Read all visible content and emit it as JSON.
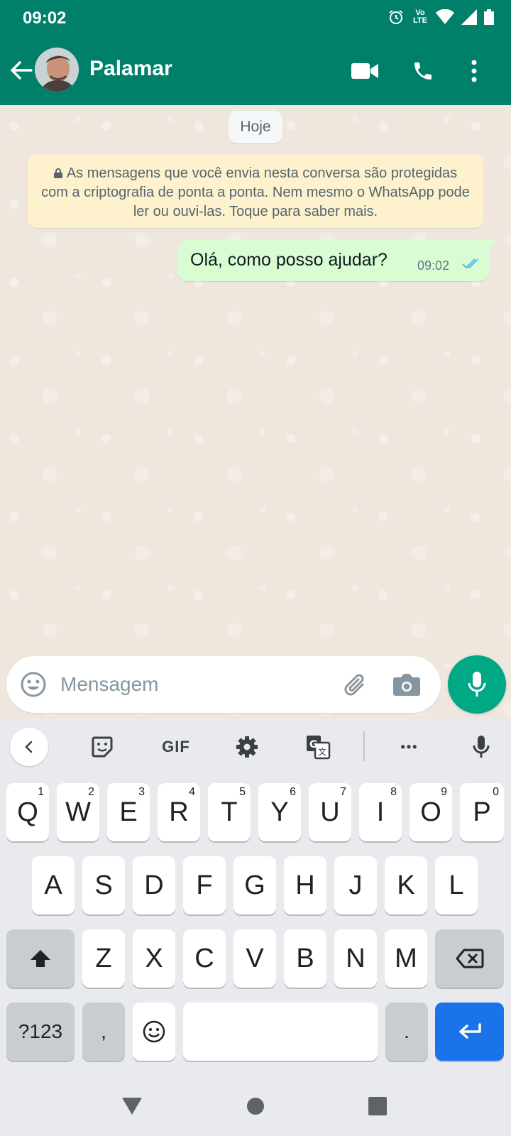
{
  "status_bar": {
    "time": "09:02",
    "volte_label": "Vo LTE",
    "icons": [
      "alarm-icon",
      "volte-icon",
      "wifi-icon",
      "signal-icon",
      "battery-icon"
    ]
  },
  "header": {
    "contact_name": "Palamar",
    "icons": [
      "back-arrow-icon",
      "video-call-icon",
      "phone-icon",
      "more-vert-icon"
    ]
  },
  "chat": {
    "date_chip": "Hoje",
    "encryption_notice": "As mensagens que você envia nesta conversa são protegidas com a criptografia de ponta a ponta. Nem mesmo o WhatsApp pode ler ou ouvi-las. Toque para saber mais.",
    "messages": [
      {
        "text": "Olá, como posso ajudar?",
        "time": "09:02",
        "status": "read"
      }
    ]
  },
  "composer": {
    "placeholder": "Mensagem",
    "icons": [
      "emoji-icon",
      "attach-icon",
      "camera-icon",
      "mic-icon"
    ]
  },
  "keyboard": {
    "toolbar": {
      "gif_label": "GIF",
      "more_label": "•••",
      "icons": [
        "chevron-left-icon",
        "sticker-icon",
        "settings-icon",
        "translate-icon",
        "more-icon",
        "voice-input-icon"
      ]
    },
    "row1": [
      {
        "label": "Q",
        "hint": "1"
      },
      {
        "label": "W",
        "hint": "2"
      },
      {
        "label": "E",
        "hint": "3"
      },
      {
        "label": "R",
        "hint": "4"
      },
      {
        "label": "T",
        "hint": "5"
      },
      {
        "label": "Y",
        "hint": "6"
      },
      {
        "label": "U",
        "hint": "7"
      },
      {
        "label": "I",
        "hint": "8"
      },
      {
        "label": "O",
        "hint": "9"
      },
      {
        "label": "P",
        "hint": "0"
      }
    ],
    "row2": [
      "A",
      "S",
      "D",
      "F",
      "G",
      "H",
      "J",
      "K",
      "L"
    ],
    "row3": [
      "Z",
      "X",
      "C",
      "V",
      "B",
      "N",
      "M"
    ],
    "symbols_label": "?123",
    "comma_label": ",",
    "period_label": ".",
    "accent_color": "#1a73e8"
  },
  "nav_bar": {
    "icons": [
      "nav-back-icon",
      "nav-home-icon",
      "nav-recents-icon"
    ]
  },
  "colors": {
    "header_green": "#008069",
    "mic_green": "#00a884",
    "outgoing_bubble": "#d9fdd3",
    "notice_yellow": "#fdf2cd",
    "read_ticks": "#53bdeb"
  }
}
